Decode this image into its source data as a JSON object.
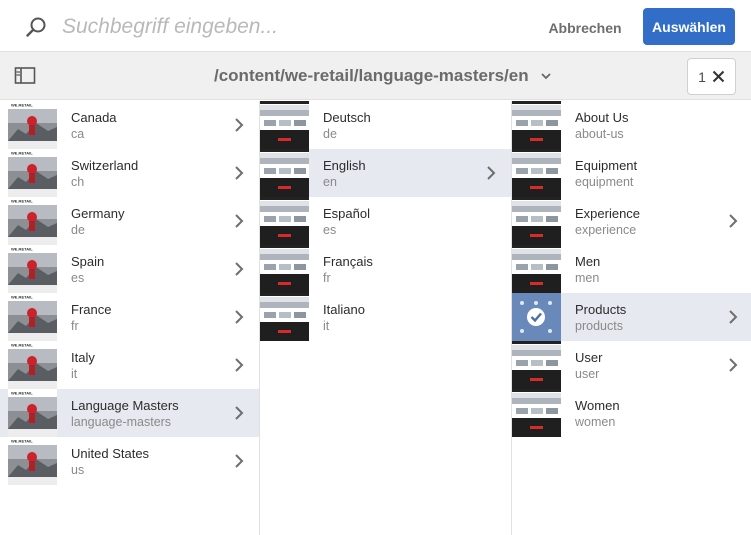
{
  "search": {
    "placeholder": "Suchbegriff eingeben...",
    "value": ""
  },
  "actions": {
    "cancel_label": "Abbrechen",
    "select_label": "Auswählen",
    "select_color": "#326ec8"
  },
  "pathbar": {
    "path": "/content/we-retail/language-masters/en",
    "selected_count": "1"
  },
  "thumb_brand": "WE.RETAIL",
  "columns": [
    {
      "items": [
        {
          "title": "Canada",
          "name": "ca",
          "has_children": true,
          "active": false
        },
        {
          "title": "Switzerland",
          "name": "ch",
          "has_children": true,
          "active": false
        },
        {
          "title": "Germany",
          "name": "de",
          "has_children": true,
          "active": false
        },
        {
          "title": "Spain",
          "name": "es",
          "has_children": true,
          "active": false
        },
        {
          "title": "France",
          "name": "fr",
          "has_children": true,
          "active": false
        },
        {
          "title": "Italy",
          "name": "it",
          "has_children": true,
          "active": false
        },
        {
          "title": "Language Masters",
          "name": "language-masters",
          "has_children": true,
          "active": true
        },
        {
          "title": "United States",
          "name": "us",
          "has_children": true,
          "active": false
        }
      ]
    },
    {
      "items": [
        {
          "title": "Deutsch",
          "name": "de",
          "has_children": false,
          "active": false
        },
        {
          "title": "English",
          "name": "en",
          "has_children": true,
          "active": true
        },
        {
          "title": "Español",
          "name": "es",
          "has_children": false,
          "active": false
        },
        {
          "title": "Français",
          "name": "fr",
          "has_children": false,
          "active": false
        },
        {
          "title": "Italiano",
          "name": "it",
          "has_children": false,
          "active": false
        }
      ]
    },
    {
      "items": [
        {
          "title": "About Us",
          "name": "about-us",
          "has_children": false,
          "active": false
        },
        {
          "title": "Equipment",
          "name": "equipment",
          "has_children": false,
          "active": false
        },
        {
          "title": "Experience",
          "name": "experience",
          "has_children": true,
          "active": false
        },
        {
          "title": "Men",
          "name": "men",
          "has_children": false,
          "active": false
        },
        {
          "title": "Products",
          "name": "products",
          "has_children": true,
          "active": true,
          "selected": true
        },
        {
          "title": "User",
          "name": "user",
          "has_children": true,
          "active": false
        },
        {
          "title": "Women",
          "name": "women",
          "has_children": false,
          "active": false
        }
      ]
    }
  ]
}
